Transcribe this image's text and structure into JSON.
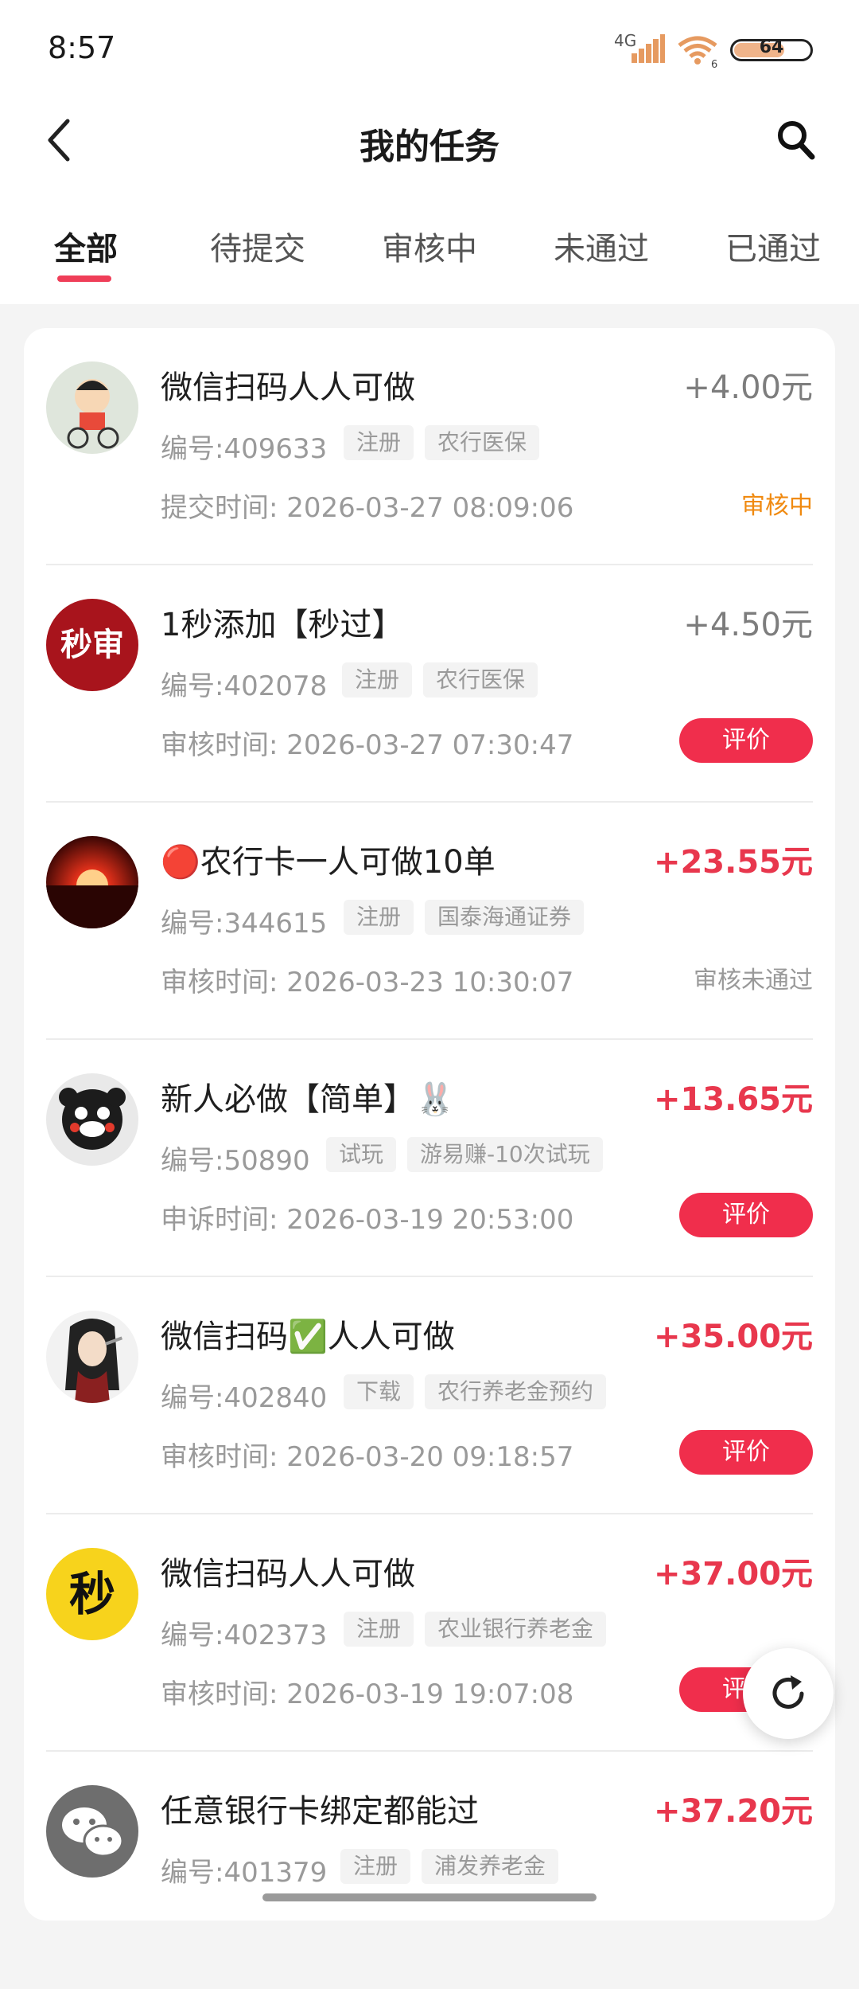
{
  "status_bar": {
    "time": "8:57",
    "network": "4G",
    "wifi_badge": "6",
    "battery": "64"
  },
  "header": {
    "title": "我的任务"
  },
  "tabs": [
    {
      "label": "全部"
    },
    {
      "label": "待提交"
    },
    {
      "label": "审核中"
    },
    {
      "label": "未通过"
    },
    {
      "label": "已通过"
    }
  ],
  "tasks": [
    {
      "title": "微信扫码人人可做",
      "amount": "+4.00元",
      "code": "编号:409633",
      "tags": [
        "注册",
        "农行医保"
      ],
      "time": "提交时间: 2026-03-27 08:09:06",
      "status": "审核中",
      "avatar": "cartoon-boy-bike"
    },
    {
      "title": "1秒添加【秒过】",
      "amount": "+4.50元",
      "code": "编号:402078",
      "tags": [
        "注册",
        "农行医保"
      ],
      "time": "审核时间: 2026-03-27 07:30:47",
      "action": "评价",
      "avatar_text": "秒审"
    },
    {
      "title": "🔴农行卡一人可做10单",
      "amount": "+23.55元",
      "code": "编号:344615",
      "tags": [
        "注册",
        "国泰海通证券"
      ],
      "time": "审核时间: 2026-03-23 10:30:07",
      "status": "审核未通过",
      "avatar": "sunset"
    },
    {
      "title": "新人必做【简单】🐰",
      "amount": "+13.65元",
      "code": "编号:50890",
      "tags": [
        "试玩",
        "游易赚-10次试玩"
      ],
      "time": "申诉时间: 2026-03-19 20:53:00",
      "action": "评价",
      "avatar": "kumamon-bear"
    },
    {
      "title": "微信扫码✅人人可做",
      "amount": "+35.00元",
      "code": "编号:402840",
      "tags": [
        "下载",
        "农行养老金预约"
      ],
      "time": "审核时间: 2026-03-20 09:18:57",
      "action": "评价",
      "avatar": "anime-character"
    },
    {
      "title": "微信扫码人人可做",
      "amount": "+37.00元",
      "code": "编号:402373",
      "tags": [
        "注册",
        "农业银行养老金"
      ],
      "time": "审核时间: 2026-03-19 19:07:08",
      "action": "评价",
      "avatar_text": "秒"
    },
    {
      "title": "任意银行卡绑定都能过",
      "amount": "+37.20元",
      "code": "编号:401379",
      "tags": [
        "注册",
        "浦发养老金"
      ],
      "avatar": "wechat-logo"
    }
  ],
  "colors": {
    "accent": "#ef3e58",
    "status_pending": "#f08a10"
  }
}
